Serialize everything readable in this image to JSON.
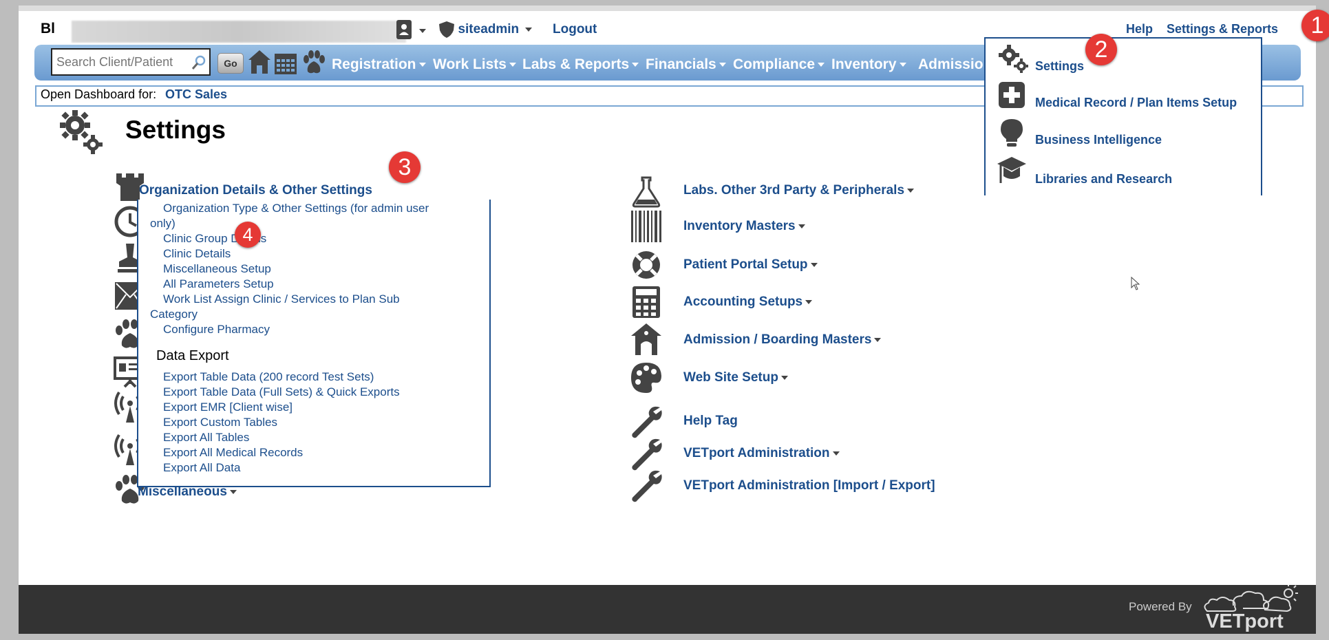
{
  "header": {
    "org_initials": "Bl",
    "user": "siteadmin",
    "logout": "Logout",
    "help": "Help",
    "settings_reports": "Settings & Reports"
  },
  "search": {
    "placeholder": "Search Client/Patient",
    "go": "Go"
  },
  "nav": {
    "items": [
      "Registration",
      "Work Lists",
      "Labs & Reports",
      "Financials",
      "Compliance",
      "Inventory",
      "Admissio"
    ]
  },
  "dashboard": {
    "label": "Open Dashboard for:",
    "value": "OTC Sales"
  },
  "page": {
    "title": "Settings"
  },
  "settings_menu": {
    "items": [
      "Settings",
      "Medical Record / Plan Items Setup",
      "Business Intelligence",
      "Libraries and Research"
    ]
  },
  "org_section": {
    "title": "Organization Details & Other Settings",
    "links": [
      {
        "line1": "Organization Type & Other Settings (for admin user",
        "line2": "only)"
      },
      {
        "line1": "Clinic Group Details"
      },
      {
        "line1": "Clinic Details"
      },
      {
        "line1": "Miscellaneous Setup"
      },
      {
        "line1": "All Parameters Setup"
      },
      {
        "line1": "Work List Assign Clinic / Services to Plan Sub",
        "line2": "Category"
      },
      {
        "line1": "Configure Pharmacy"
      }
    ],
    "export_heading": "Data Export",
    "export_links": [
      "Export Table Data (200 record Test Sets)",
      "Export Table Data (Full Sets) & Quick Exports",
      "Export EMR [Client wise]",
      "Export Custom Tables",
      "Export All Tables",
      "Export All Medical Records",
      "Export All Data"
    ],
    "misc": "Miscellaneous"
  },
  "right_section": {
    "items": [
      "Labs. Other 3rd Party & Peripherals",
      "Inventory Masters",
      "Patient Portal Setup",
      "Accounting Setups",
      "Admission / Boarding Masters",
      "Web Site Setup",
      "Help Tag",
      "VETport Administration",
      "VETport Administration [Import / Export]"
    ]
  },
  "badges": [
    "1",
    "2",
    "3",
    "4"
  ],
  "footer": {
    "powered_by": "Powered By",
    "brand": "VETport"
  },
  "colors": {
    "link": "#1c4e8c",
    "badge": "#e53935",
    "navbar": "#7aa7d4"
  }
}
